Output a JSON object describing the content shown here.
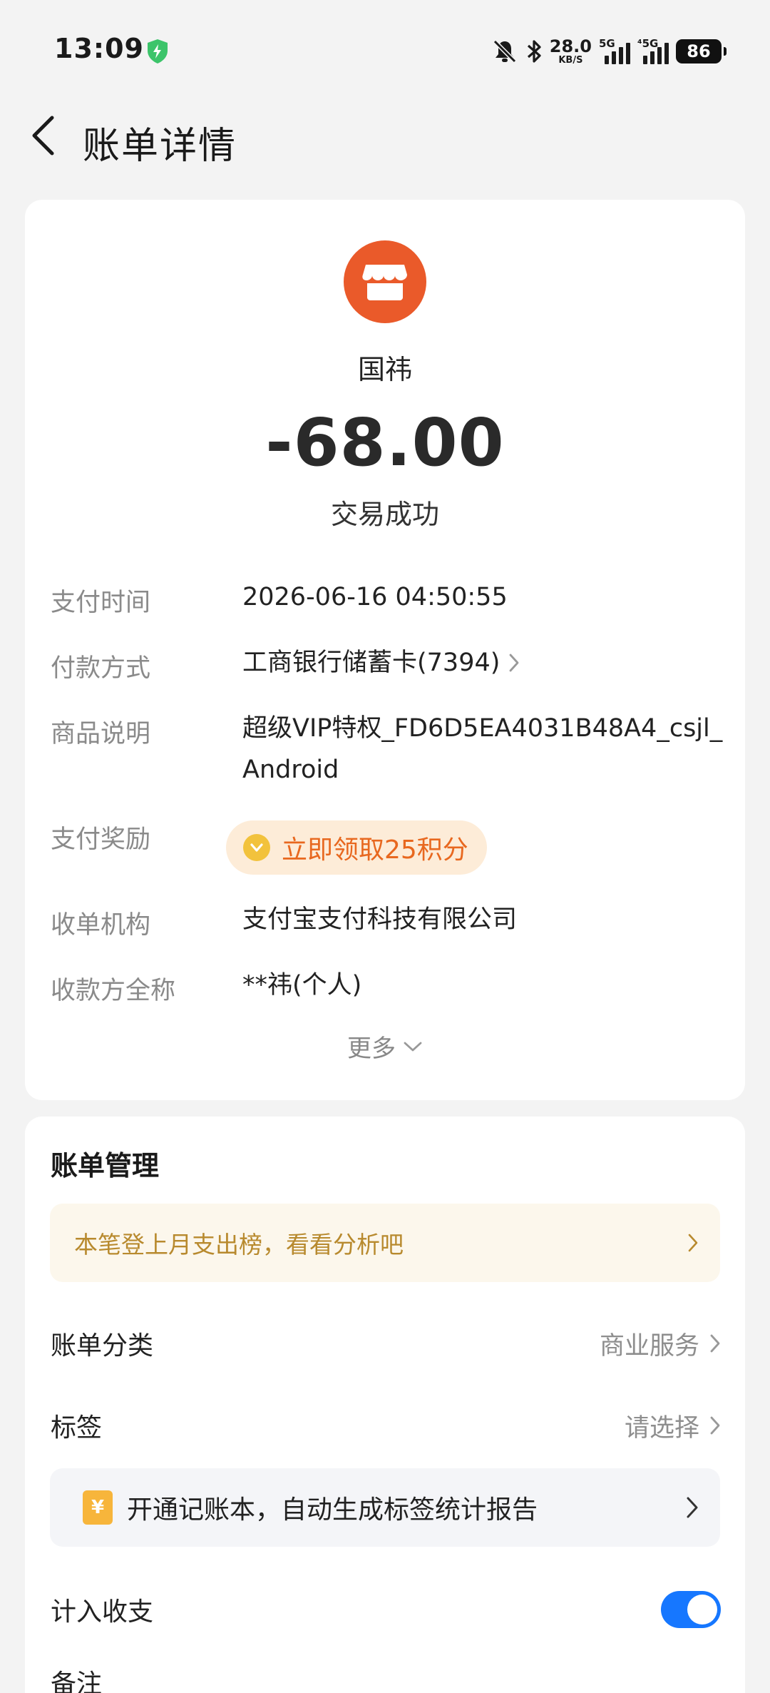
{
  "status_bar": {
    "time": "13:09",
    "net_speed_value": "28.0",
    "net_speed_unit": "KB/S",
    "signal_1_tag": "5G",
    "signal_2_tag": "⁴5G",
    "battery": "86",
    "icons": [
      "shield-check-icon",
      "bell-off-icon",
      "bluetooth-icon",
      "signal-icon",
      "signal-icon",
      "battery-icon"
    ]
  },
  "header": {
    "title": "账单详情",
    "back_icon": "chevron-left-icon"
  },
  "transaction": {
    "merchant_icon": "store-icon",
    "merchant_name": "国祎",
    "amount": "-68.00",
    "status": "交易成功",
    "accent_color": "#ea5a2a"
  },
  "details": {
    "pay_time_label": "支付时间",
    "pay_time_value": "2026-06-16 04:50:55",
    "pay_method_label": "付款方式",
    "pay_method_value": "工商银行储蓄卡(7394)",
    "product_label": "商品说明",
    "product_value": "超级VIP特权_FD6D5EA4031B48A4_csjl_Android",
    "reward_label": "支付奖励",
    "reward_value": "立即领取25积分",
    "acquirer_label": "收单机构",
    "acquirer_value": "支付宝支付科技有限公司",
    "payee_label": "收款方全称",
    "payee_value": "**祎(个人)",
    "more": "更多"
  },
  "management": {
    "title": "账单管理",
    "tip": "本笔登上月支出榜，看看分析吧",
    "category_label": "账单分类",
    "category_value": "商业服务",
    "tag_label": "标签",
    "tag_value": "请选择",
    "ledger_promo": "开通记账本，自动生成标签统计报告",
    "ledger_icon_glyph": "¥",
    "include_label": "计入收支",
    "include_enabled": true,
    "toggle_color": "#1677ff",
    "note_label": "备注"
  }
}
